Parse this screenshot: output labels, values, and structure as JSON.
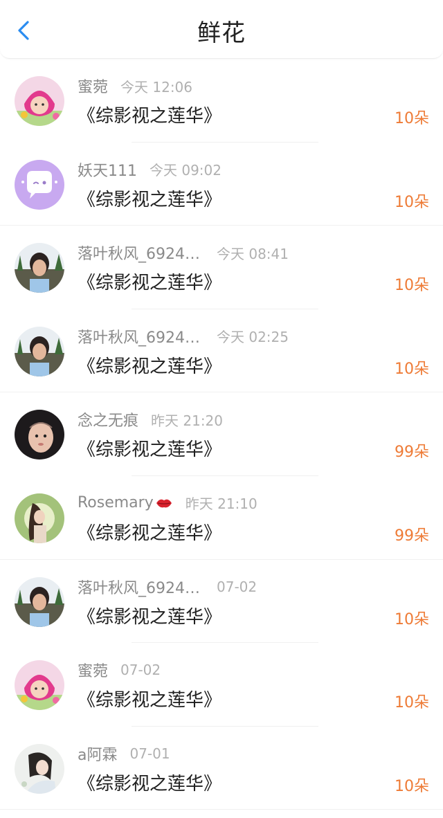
{
  "header": {
    "title": "鲜花",
    "back_icon": "chevron-left-icon"
  },
  "colors": {
    "accent": "#2a8cf0",
    "amount": "#ee7b36",
    "name": "#8a8a8a",
    "time": "#b0b0b0"
  },
  "items": [
    {
      "name": "蜜菀",
      "time": "今天 12:06",
      "book": "《综影视之莲华》",
      "amount": "10朵"
    },
    {
      "name": "妖天111",
      "time": "今天 09:02",
      "book": "《综影视之莲华》",
      "amount": "10朵"
    },
    {
      "name": "落叶秋风_6924…",
      "time": "今天 08:41",
      "book": "《综影视之莲华》",
      "amount": "10朵"
    },
    {
      "name": "落叶秋风_6924…",
      "time": "今天 02:25",
      "book": "《综影视之莲华》",
      "amount": "10朵"
    },
    {
      "name": "念之无痕",
      "time": "昨天 21:20",
      "book": "《综影视之莲华》",
      "amount": "99朵"
    },
    {
      "name": "Rosemary",
      "time": "昨天 21:10",
      "book": "《综影视之莲华》",
      "amount": "99朵"
    },
    {
      "name": "落叶秋风_6924…",
      "time": "07-02",
      "book": "《综影视之莲华》",
      "amount": "10朵"
    },
    {
      "name": "蜜菀",
      "time": "07-02",
      "book": "《综影视之莲华》",
      "amount": "10朵"
    },
    {
      "name": "a阿霖",
      "time": "07-01",
      "book": "《综影视之莲华》",
      "amount": "10朵"
    }
  ]
}
